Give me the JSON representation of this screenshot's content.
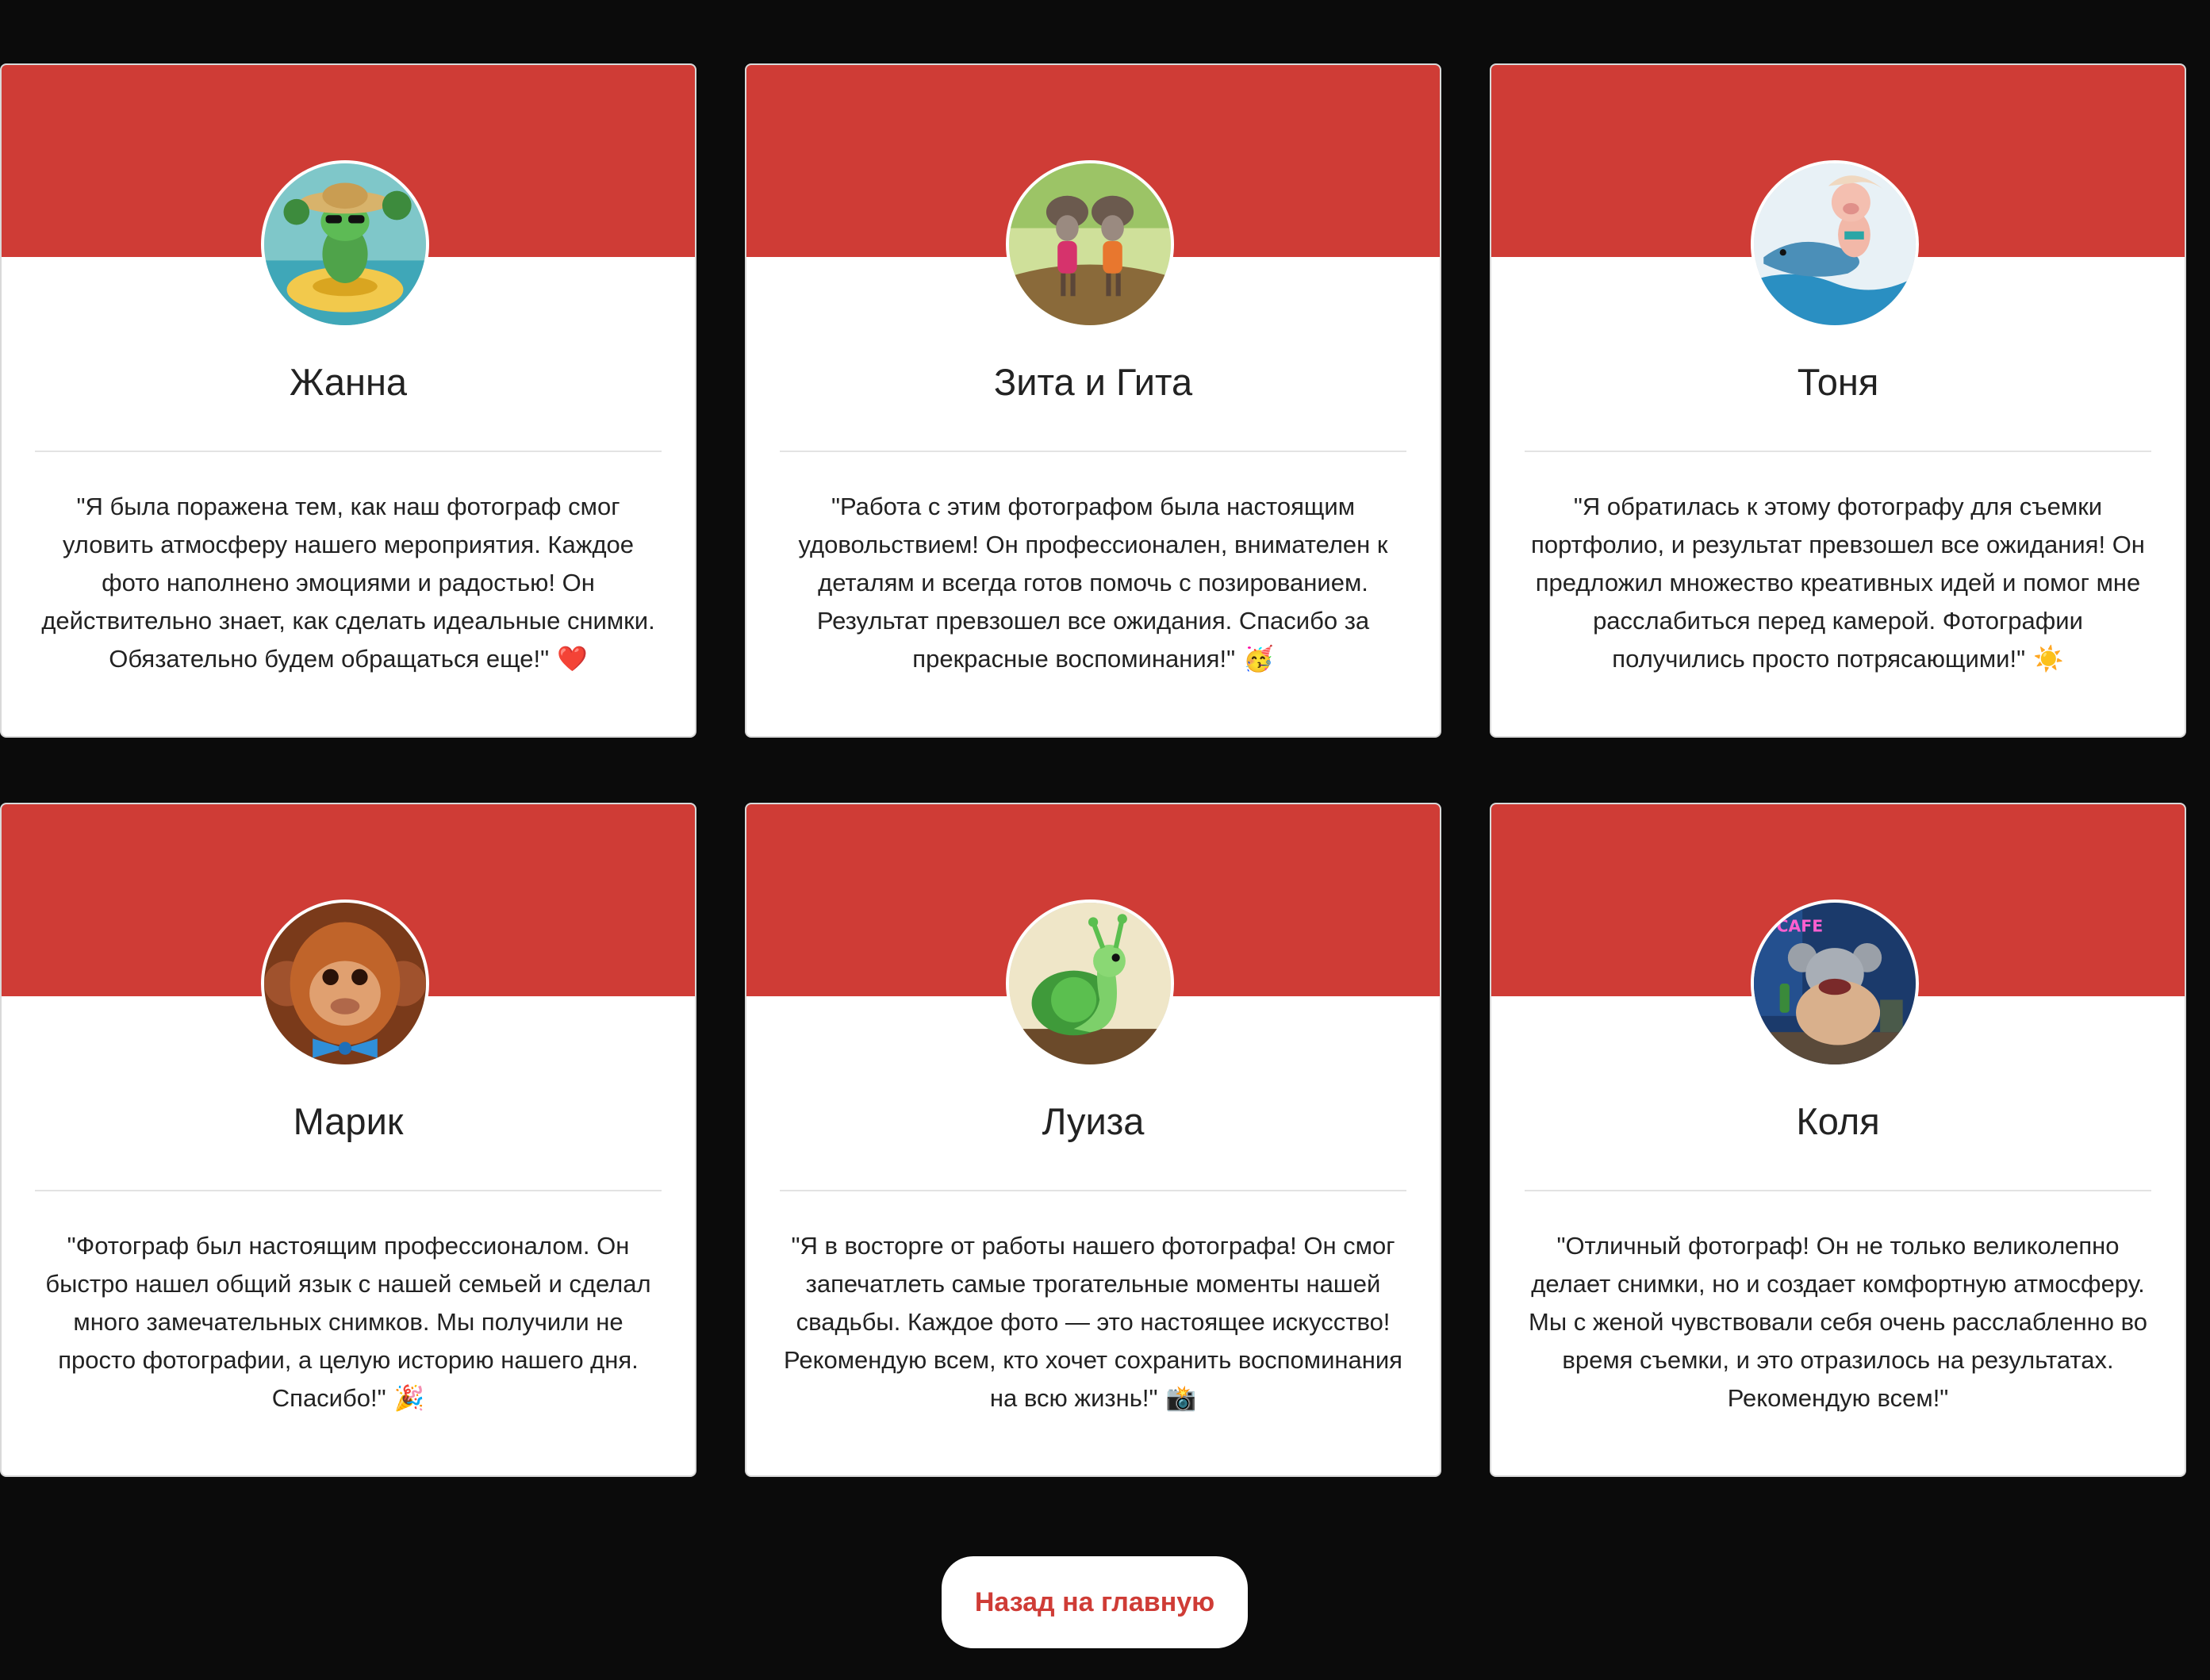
{
  "accent_color": "#cf3c36",
  "background_color": "#0b0b0b",
  "testimonials": [
    {
      "name": "Жанна",
      "avatar_icon": "frog-avatar",
      "quote": "\"Я была поражена тем, как наш фотограф смог уловить атмосферу нашего мероприятия. Каждое фото наполнено эмоциями и радостью! Он действительно знает, как сделать идеальные снимки. Обязательно будем обращаться еще!\"",
      "emoji": "❤️"
    },
    {
      "name": "Зита и Гита",
      "avatar_icon": "twins-avatar",
      "quote": "\"Работа с этим фотографом была настоящим удовольствием! Он профессионален, внимателен к деталям и всегда готов помочь с позированием. Результат превзошел все ожидания. Спасибо за прекрасные воспоминания!\"",
      "emoji": "🥳"
    },
    {
      "name": "Тоня",
      "avatar_icon": "pig-dolphin-avatar",
      "quote": "\"Я обратилась к этому фотографу для съемки портфолио, и результат превзошел все ожидания! Он предложил множество креативных идей и помог мне расслабиться перед камерой. Фотографии получились просто потрясающими!\"",
      "emoji": "☀️"
    },
    {
      "name": "Марик",
      "avatar_icon": "orangutan-avatar",
      "quote": "\"Фотограф был настоящим профессионалом. Он быстро нашел общий язык с нашей семьей и сделал много замечательных снимков. Мы получили не просто фотографии, а целую историю нашего дня. Спасибо!\"",
      "emoji": "🎉"
    },
    {
      "name": "Луиза",
      "avatar_icon": "snail-avatar",
      "quote": "\"Я в восторге от работы нашего фотографа! Он смог запечатлеть самые трогательные моменты нашей свадьбы. Каждое фото — это настоящее искусство! Рекомендую всем, кто хочет сохранить воспоминания на всю жизнь!\"",
      "emoji": "📸"
    },
    {
      "name": "Коля",
      "avatar_icon": "rat-avatar",
      "quote": "\"Отличный фотограф! Он не только великолепно делает снимки, но и создает комфортную атмосферу. Мы с женой чувствовали себя очень расслабленно во время съемки, и это отразилось на результатах. Рекомендую всем!\"",
      "emoji": "",
      "avatar_sign": "CAFE"
    }
  ],
  "back_button": {
    "label": "Назад на главную"
  }
}
